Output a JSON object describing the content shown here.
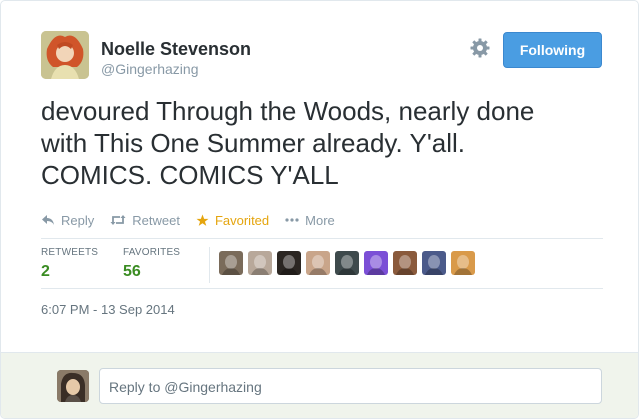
{
  "author": {
    "name": "Noelle Stevenson",
    "handle": "@Gingerhazing"
  },
  "follow_button": {
    "label": "Following"
  },
  "tweet": {
    "lines": [
      "devoured Through the Woods, nearly done",
      "with This One Summer already. Y'all.",
      "COMICS. COMICS Y'ALL"
    ]
  },
  "actions": [
    {
      "label": "Reply",
      "icon": "reply-icon"
    },
    {
      "label": "Retweet",
      "icon": "retweet-icon"
    },
    {
      "label": "Favorited",
      "icon": "star-icon"
    },
    {
      "label": "More",
      "icon": "more-icon"
    }
  ],
  "stats": {
    "retweets": {
      "label": "RETWEETS",
      "value": "2"
    },
    "favorites": {
      "label": "FAVORITES",
      "value": "56"
    }
  },
  "favoriters": [
    {
      "icon": "avatar-1",
      "color": "#7a6b5a"
    },
    {
      "icon": "avatar-2",
      "color": "#b8a89a"
    },
    {
      "icon": "avatar-3",
      "color": "#2b2622"
    },
    {
      "icon": "avatar-4",
      "color": "#c9a58a"
    },
    {
      "icon": "avatar-5",
      "color": "#3e4a4c"
    },
    {
      "icon": "avatar-6",
      "color": "#7b4fd6"
    },
    {
      "icon": "avatar-7",
      "color": "#8a5a3c"
    },
    {
      "icon": "avatar-8",
      "color": "#4b5a8a"
    },
    {
      "icon": "avatar-9",
      "color": "#d99a4a"
    }
  ],
  "timestamp": "6:07 PM - 13 Sep 2014",
  "reply": {
    "placeholder": "Reply to @Gingerhazing"
  },
  "colors": {
    "accent": "#4a9de2",
    "favorited": "#e5a50e",
    "stat_value": "#3a8c22"
  }
}
